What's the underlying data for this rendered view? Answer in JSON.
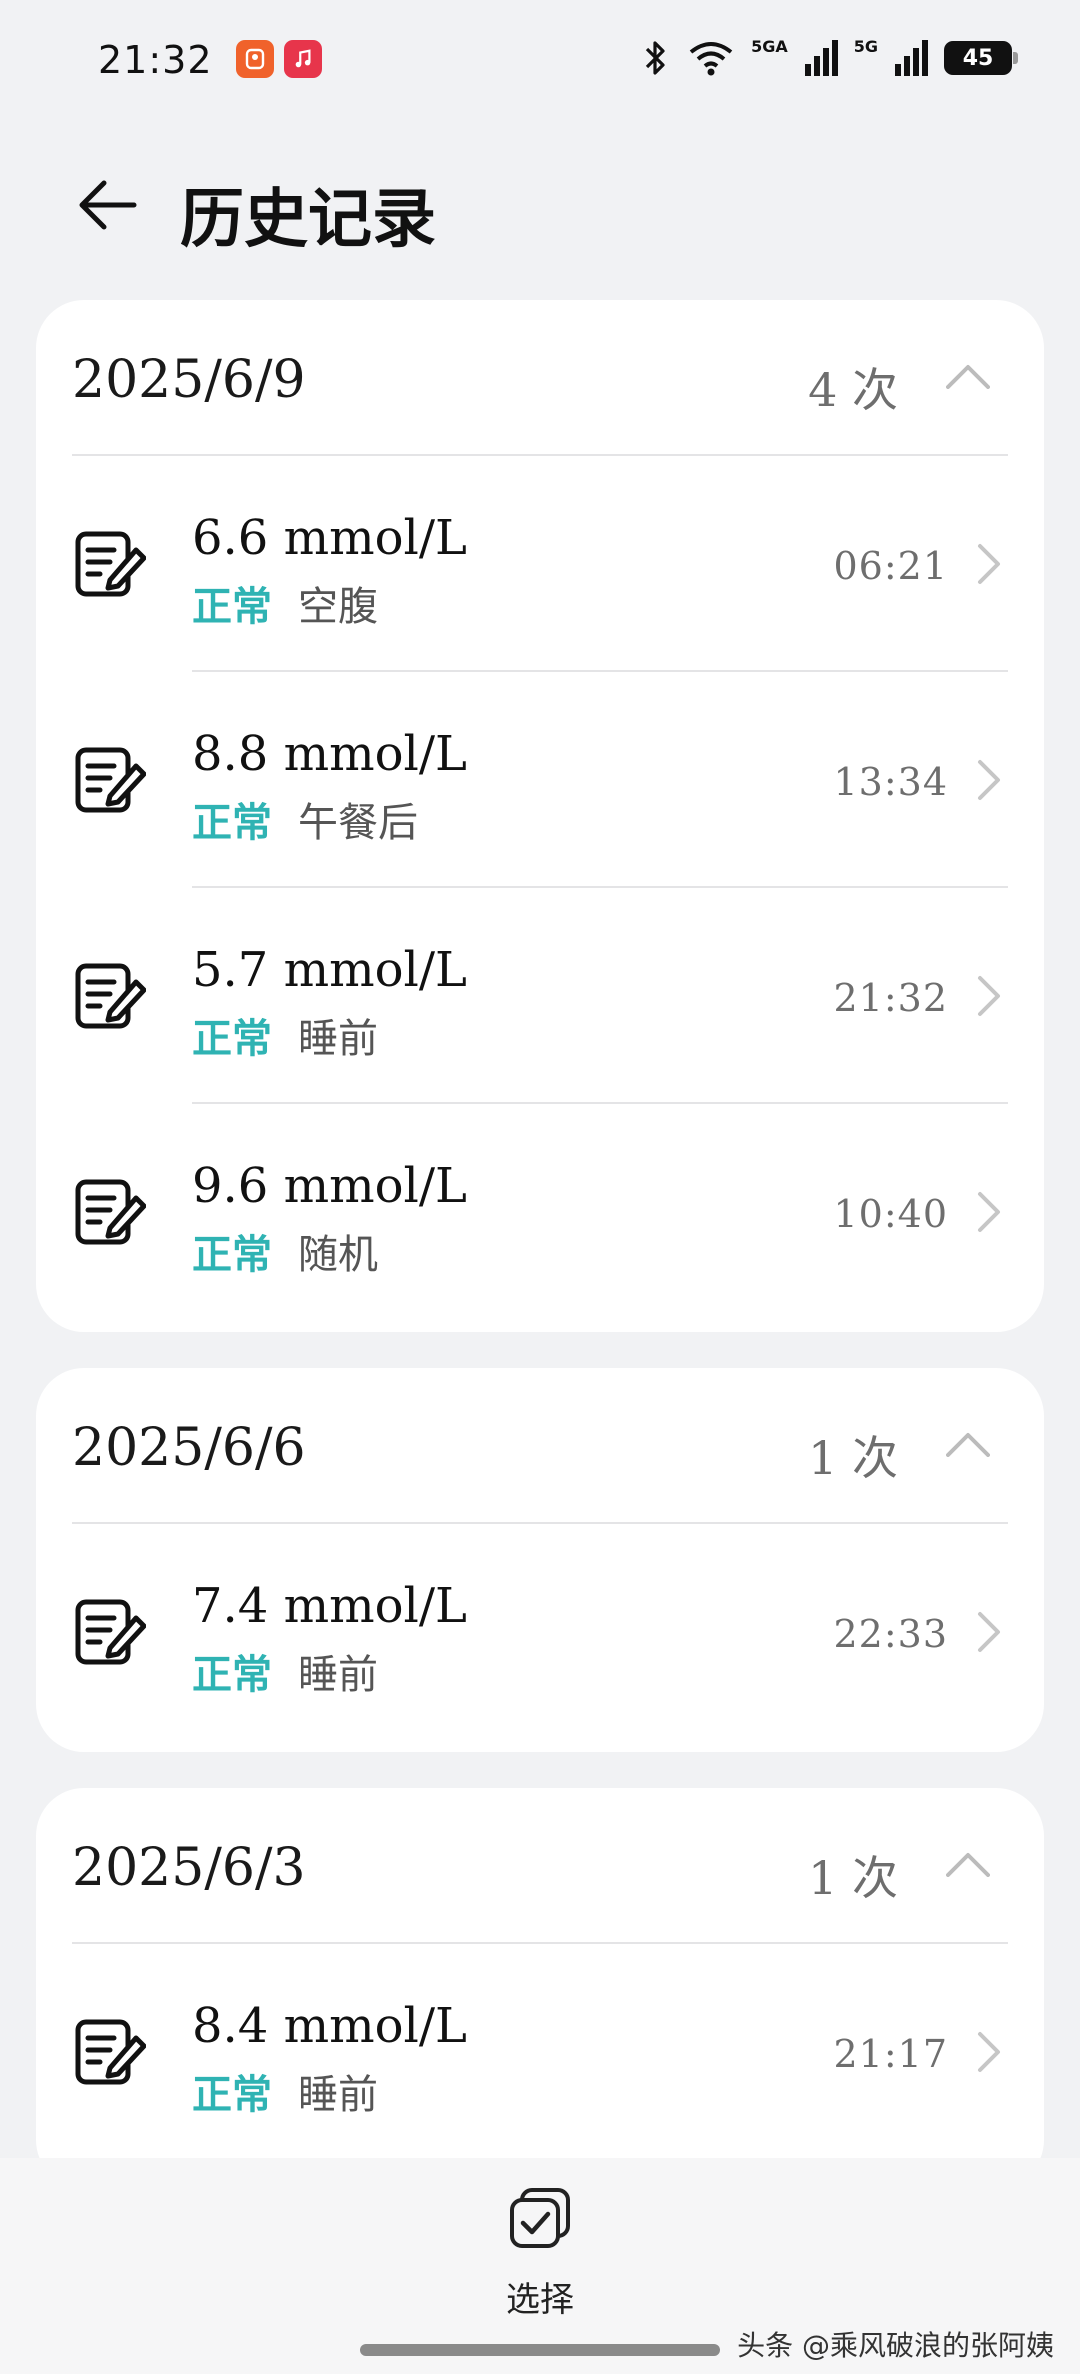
{
  "status_bar": {
    "time": "21:32",
    "network_labels": [
      "5GA",
      "5G"
    ],
    "battery": "45"
  },
  "header": {
    "title": "历史记录"
  },
  "groups": [
    {
      "date": "2025/6/9",
      "count": "4 次",
      "records": [
        {
          "value": "6.6 mmol/L",
          "status": "正常",
          "type": "空腹",
          "time": "06:21"
        },
        {
          "value": "8.8 mmol/L",
          "status": "正常",
          "type": "午餐后",
          "time": "13:34"
        },
        {
          "value": "5.7 mmol/L",
          "status": "正常",
          "type": "睡前",
          "time": "21:32"
        },
        {
          "value": "9.6 mmol/L",
          "status": "正常",
          "type": "随机",
          "time": "10:40"
        }
      ]
    },
    {
      "date": "2025/6/6",
      "count": "1 次",
      "records": [
        {
          "value": "7.4 mmol/L",
          "status": "正常",
          "type": "睡前",
          "time": "22:33"
        }
      ]
    },
    {
      "date": "2025/6/3",
      "count": "1 次",
      "records": [
        {
          "value": "8.4 mmol/L",
          "status": "正常",
          "type": "睡前",
          "time": "21:17"
        }
      ]
    }
  ],
  "bottom_bar": {
    "select_label": "选择"
  },
  "watermark": "头条 @乘风破浪的张阿姨",
  "colors": {
    "background": "#f1f2f4",
    "card": "#ffffff",
    "status_normal": "#2fb3b3"
  }
}
